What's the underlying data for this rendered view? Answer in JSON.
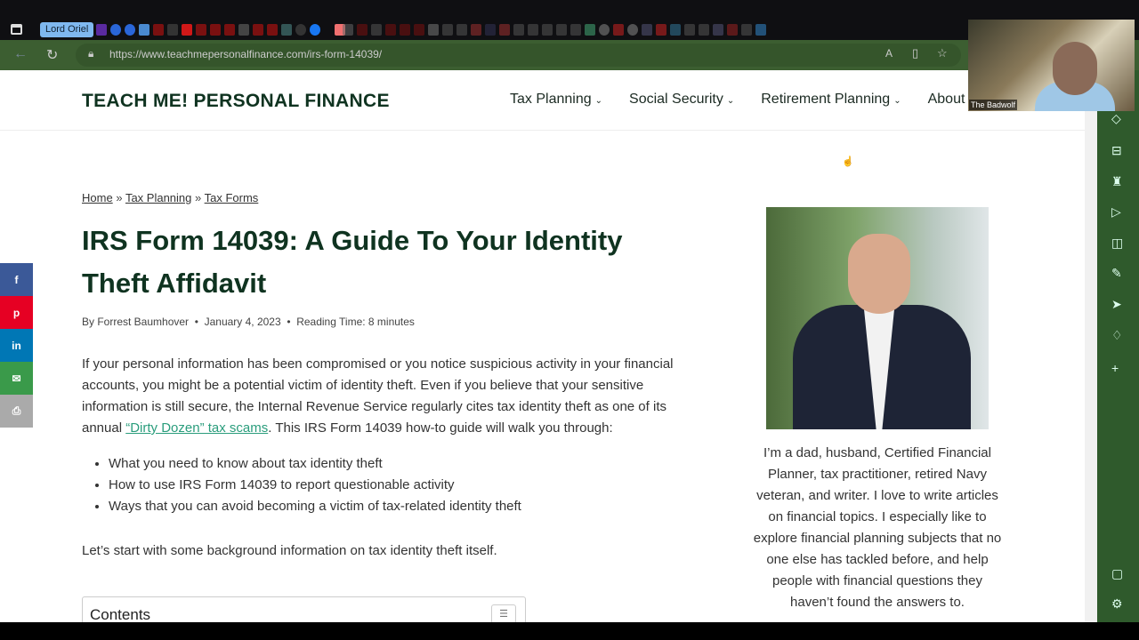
{
  "browser": {
    "profile_label": "Lord Oriel",
    "url_host": "https://www.teachmepersonalfinance.com/",
    "url_path": "irs-form-14039/"
  },
  "site": {
    "logo": "TEACH ME! PERSONAL FINANCE",
    "nav": [
      {
        "label": "Tax Planning"
      },
      {
        "label": "Social Security"
      },
      {
        "label": "Retirement Planning"
      },
      {
        "label": "About"
      }
    ]
  },
  "breadcrumb": {
    "items": [
      "Home",
      "Tax Planning",
      "Tax Forms"
    ],
    "sep": "»"
  },
  "article": {
    "title": "IRS Form 14039: A Guide To Your Identity Theft Affidavit",
    "author": "By Forrest Baumhover",
    "date": "January 4, 2023",
    "reading_time": "Reading Time: 8 minutes",
    "intro_before": "If your personal information has been compromised or you notice suspicious activity in your financial accounts, you might be a potential victim of identity theft. Even if you believe that your sensitive information is still secure, the Internal Revenue Service regularly cites tax identity theft as one of its annual ",
    "intro_link": "“Dirty Dozen” tax scams",
    "intro_after": ". This IRS Form 14039 how-to guide will walk you through:",
    "bullets": [
      "What you need to know about tax identity theft",
      "How to use IRS Form 14039 to report questionable activity",
      "Ways that you can avoid becoming a victim of tax-related identity theft"
    ],
    "after": "Let’s start with some background information on tax identity theft itself.",
    "toc_title": "Contents"
  },
  "sidebar": {
    "bio": "I’m a dad, husband, Certified Financial Planner, tax practitioner, retired Navy veteran, and writer. I love to write articles on financial topics. I especially like to explore financial planning subjects that no one else has tackled before, and help people with financial questions they haven’t found the answers to."
  },
  "share": [
    {
      "icon": "facebook-icon",
      "glyph": "f",
      "color": "#3b5998"
    },
    {
      "icon": "pinterest-icon",
      "glyph": "p",
      "color": "#e60023"
    },
    {
      "icon": "linkedin-icon",
      "glyph": "in",
      "color": "#0077b5"
    },
    {
      "icon": "email-icon",
      "glyph": "✉",
      "color": "#3a9a4a"
    },
    {
      "icon": "print-icon",
      "glyph": "⎙",
      "color": "#aaaaaa"
    }
  ],
  "webcam": {
    "label": "The Badwolf"
  }
}
